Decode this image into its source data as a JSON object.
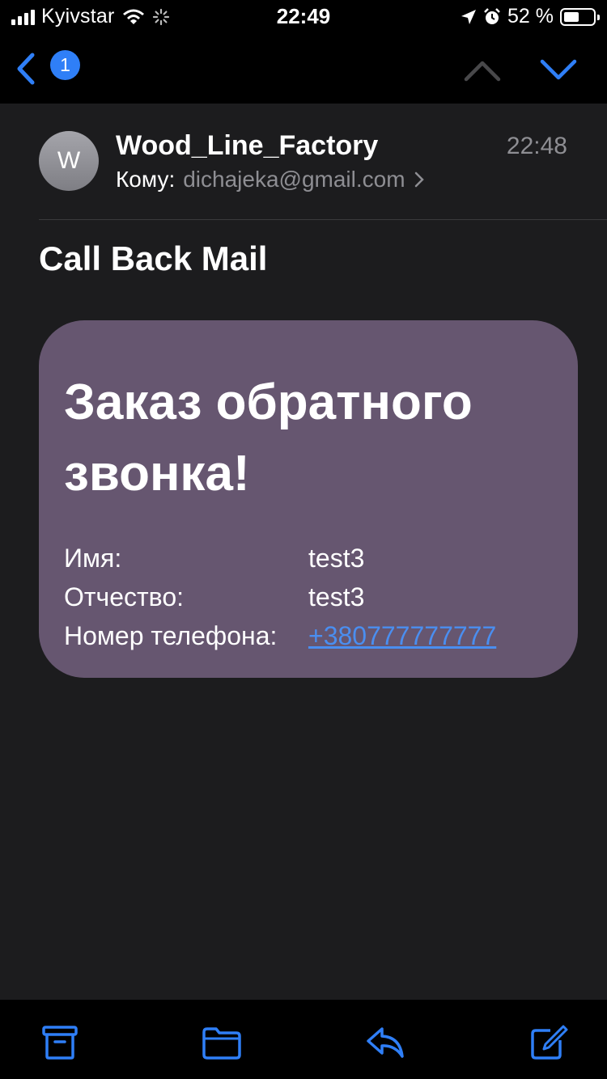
{
  "status_bar": {
    "carrier": "Kyivstar",
    "time": "22:49",
    "battery_percent_text": "52 %",
    "battery_level": 0.52,
    "icons": [
      "signal-bars-icon",
      "wifi-icon",
      "activity-spinner-icon",
      "location-arrow-icon",
      "alarm-icon",
      "battery-icon"
    ]
  },
  "nav": {
    "unread_count": "1",
    "icons": [
      "chevron-left-icon",
      "chevron-up-icon",
      "chevron-down-icon"
    ]
  },
  "message": {
    "avatar_initial": "W",
    "sender": "Wood_Line_Factory",
    "time": "22:48",
    "to_label": "Кому:",
    "to_email": "dichajeka@gmail.com",
    "subject": "Call Back Mail"
  },
  "card": {
    "background": "#665670",
    "title": "Заказ обратного звонка!",
    "fields": [
      {
        "label": "Имя:",
        "value": "test3"
      },
      {
        "label": "Отчество:",
        "value": "test3"
      },
      {
        "label": "Номер телефона:",
        "value": "+380777777777"
      }
    ]
  },
  "toolbar": {
    "icons": [
      "archive-icon",
      "folder-icon",
      "reply-icon",
      "compose-icon"
    ],
    "accent": "#2f7ff7"
  }
}
